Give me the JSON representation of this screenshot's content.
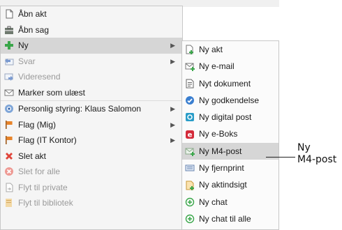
{
  "main_menu": [
    {
      "label": "Åbn akt",
      "icon": "document-icon"
    },
    {
      "label": "Åbn sag",
      "icon": "case-icon"
    },
    {
      "label": "Ny",
      "icon": "plus-icon",
      "submenu": true
    },
    {
      "label": "Svar",
      "icon": "reply-icon",
      "submenu": true,
      "disabled": true
    },
    {
      "label": "Videresend",
      "icon": "forward-icon",
      "disabled": true
    },
    {
      "label": "Marker som ulæst",
      "icon": "envelope-icon"
    },
    {
      "label": "Personlig styring: Klaus Salomon",
      "icon": "eye-icon",
      "submenu": true
    },
    {
      "label": "Flag (Mig)",
      "icon": "flag-icon",
      "submenu": true
    },
    {
      "label": "Flag (IT Kontor)",
      "icon": "flag-icon",
      "submenu": true
    },
    {
      "label": "Slet akt",
      "icon": "delete-x-icon"
    },
    {
      "label": "Slet for alle",
      "icon": "delete-circle-icon",
      "disabled": true
    },
    {
      "label": "Flyt til private",
      "icon": "move-document-icon",
      "disabled": true
    },
    {
      "label": "Flyt til bibliotek",
      "icon": "library-icon",
      "disabled": true
    }
  ],
  "sub_menu": [
    {
      "label": "Ny akt",
      "icon": "new-document-icon"
    },
    {
      "label": "Ny e-mail",
      "icon": "new-email-icon"
    },
    {
      "label": "Nyt dokument",
      "icon": "new-word-document-icon"
    },
    {
      "label": "Ny godkendelse",
      "icon": "approval-icon"
    },
    {
      "label": "Ny digital post",
      "icon": "digital-post-icon"
    },
    {
      "label": "Ny e-Boks",
      "icon": "eboks-icon"
    },
    {
      "label": "Ny M4-post",
      "icon": "m4-post-icon"
    },
    {
      "label": "Ny fjernprint",
      "icon": "remote-print-icon"
    },
    {
      "label": "Ny aktindsigt",
      "icon": "access-request-icon"
    },
    {
      "label": "Ny chat",
      "icon": "chat-icon"
    },
    {
      "label": "Ny chat til alle",
      "icon": "chat-all-icon"
    }
  ],
  "callout": {
    "line1": "Ny",
    "line2": "M4-post"
  },
  "colors": {
    "highlight": "#d6d6d6",
    "menu_bg": "#f5f5f5",
    "plus_green": "#3aa64a",
    "delete_red": "#e0443a",
    "eboks_red": "#d42b3a",
    "flag_orange": "#e8842a"
  }
}
